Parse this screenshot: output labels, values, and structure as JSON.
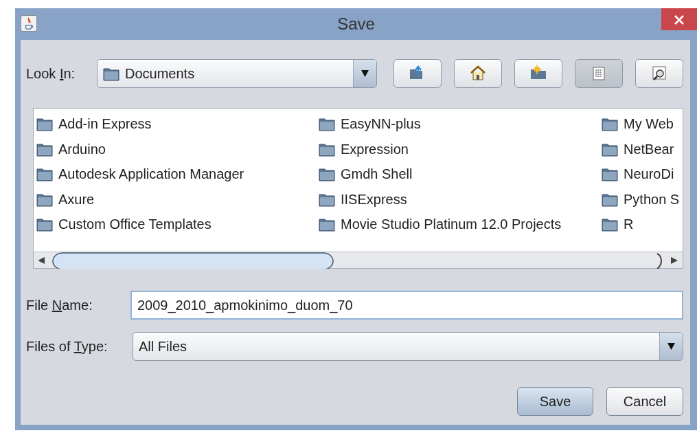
{
  "window": {
    "title": "Save"
  },
  "look_in": {
    "label": {
      "before": "Look ",
      "key": "I",
      "after": "n:"
    },
    "value": "Documents"
  },
  "toolbar": [
    {
      "kind": "up",
      "selected": false
    },
    {
      "kind": "home",
      "selected": false
    },
    {
      "kind": "new-folder",
      "selected": false
    },
    {
      "kind": "list",
      "selected": true
    },
    {
      "kind": "details",
      "selected": false
    }
  ],
  "files": {
    "columns": [
      {
        "items": [
          "Add-in Express",
          "Arduino",
          "Autodesk Application Manager",
          "Axure",
          "Custom Office Templates"
        ]
      },
      {
        "items": [
          "EasyNN-plus",
          "Expression",
          "Gmdh Shell",
          "IISExpress",
          "Movie Studio Platinum 12.0 Projects"
        ]
      },
      {
        "items": [
          "My Web",
          "NetBear",
          "NeuroDi",
          "Python S",
          "R"
        ]
      }
    ]
  },
  "file_name": {
    "label": {
      "before": "File ",
      "key": "N",
      "after": "ame:"
    },
    "value": "2009_2010_apmokinimo_duom_70"
  },
  "file_type": {
    "label": {
      "before": "Files of ",
      "key": "T",
      "after": "ype:"
    },
    "value": "All Files"
  },
  "buttons": [
    {
      "label": "Save",
      "default": true
    },
    {
      "label": "Cancel",
      "default": false
    }
  ]
}
